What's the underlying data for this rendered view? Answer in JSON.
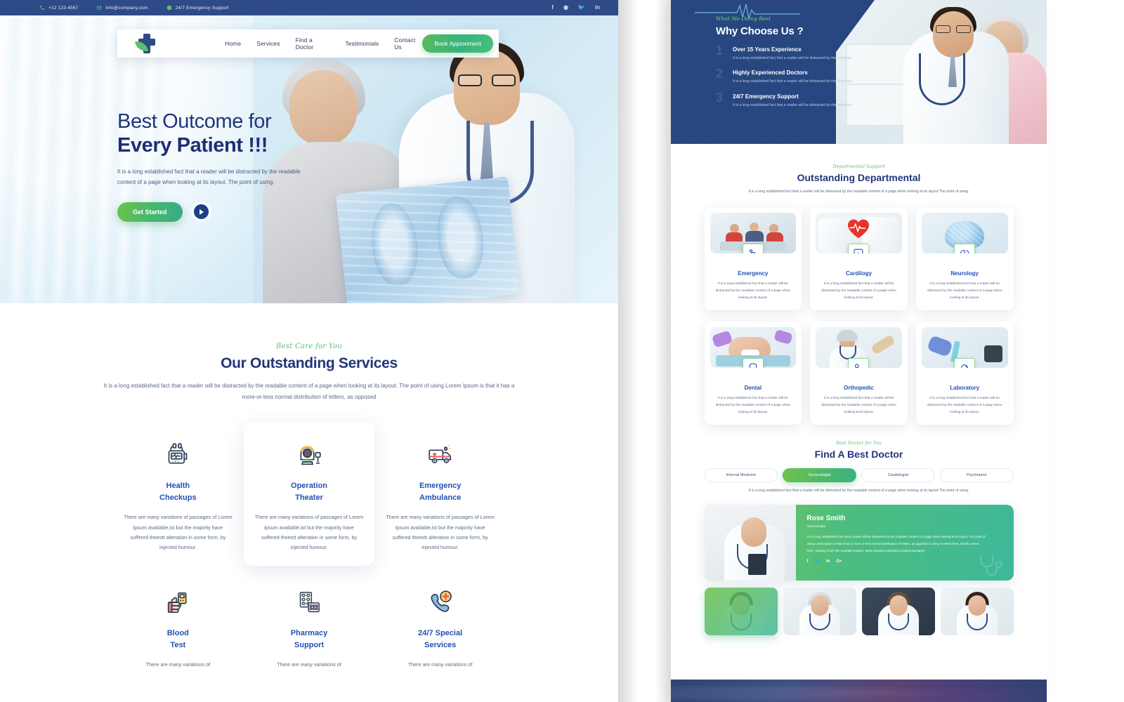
{
  "topbar": {
    "phone": "+12 123 4567",
    "email": "info@company.com",
    "support": "24/7 Emergency Support",
    "social": [
      "f",
      "◉",
      "🐦",
      "in"
    ]
  },
  "nav": {
    "logo_alt": "medical-cross-leaf-logo",
    "links": [
      "Home",
      "Services",
      "Find a Doctor",
      "Testimonials",
      "Contact Us"
    ],
    "cta": "Book Appionment"
  },
  "hero": {
    "line1": "Best Outcome for",
    "line2": "Every Patient !!!",
    "paragraph": "It is a long established fact that a reader will be distracted by the readable content of a page when looking at its layout. The point of using.",
    "primary_button": "Get Started",
    "play_label": "play-video"
  },
  "services": {
    "script": "Best Care for You",
    "title": "Our Outstanding Services",
    "subtitle": "It is a long established fact that a reader will be distracted by the readable content of a page when looking at its layout. The point of using Lorem Ipsum is that it has a more-or-less normal distribution of letters, as opposed",
    "items": [
      {
        "name": "Health\nCheckups",
        "icon": "monitor-icon",
        "desc": "There are many variations of passages of Lorem Ipsum available,ist but the majority have suffered theestt alteration in some form, by injected humour.",
        "highlight": false
      },
      {
        "name": "Operation\nTheater",
        "icon": "mri-scanner-icon",
        "desc": "There are many variations of passages of Lorem Ipsum available,ist but the majority have suffered theestt alteration in some form, by injected humour.",
        "highlight": true
      },
      {
        "name": "Emergency\nAmbulance",
        "icon": "ambulance-icon",
        "desc": "There are many variations of passages of Lorem Ipsum available,ist but the majority have suffered theestt alteration in some form, by injected humour.",
        "highlight": false
      },
      {
        "name": "Blood\nTest",
        "icon": "glucometer-icon",
        "desc": "There are many variations of",
        "highlight": false
      },
      {
        "name": "Pharmacy\nSupport",
        "icon": "pills-icon",
        "desc": "There are many variations of",
        "highlight": false
      },
      {
        "name": "24/7 Special\nServices",
        "icon": "phone-medical-icon",
        "desc": "There are many variations of",
        "highlight": false
      }
    ]
  },
  "why": {
    "script": "What We Doing Best",
    "title": "Why Choose Us ?",
    "items": [
      {
        "num": "1",
        "heading": "Over 15 Years Experience",
        "desc": "It is a long established fact that a reader will be distracted by the readable."
      },
      {
        "num": "2",
        "heading": "Highly Experienced Doctors",
        "desc": "It is a long established fact that a reader will be distracted by the readable."
      },
      {
        "num": "3",
        "heading": "24/7 Emergency Support",
        "desc": "It is a long established fact that a reader will be distracted by the readable."
      }
    ]
  },
  "departmental": {
    "script": "Departmental Support",
    "title": "Outstanding Departmental",
    "subtitle": "It is a long established fact that a reader will be distracted by the readable content of a page when looking at its layout The point of using.",
    "cards": [
      {
        "name": "Emergency",
        "icon": "stretcher-icon",
        "desc": "It is a long established fact that a reader will be distracted by the readable content of a page when looking at its layout."
      },
      {
        "name": "Cardilogy",
        "icon": "heart-monitor-icon",
        "desc": "It is a long established fact that a reader will be distracted by the readable content of a page when looking at its layout."
      },
      {
        "name": "Neurology",
        "icon": "brain-icon",
        "desc": "It is a long established fact that a reader will be distracted by the readable content of a page when looking at its layout."
      },
      {
        "name": "Dental",
        "icon": "tooth-icon",
        "desc": "It is a long established fact that a reader will be distracted by the readable content of a page when looking at its layout."
      },
      {
        "name": "Orthopedic",
        "icon": "bone-joint-icon",
        "desc": "It is a long established fact that a reader will be distracted by the readable content of a page when looking at its layout."
      },
      {
        "name": "Laboratory",
        "icon": "microscope-icon",
        "desc": "It is a long established fact that a reader will be distracted by the readable content of a page when looking at its layout."
      }
    ]
  },
  "find_doctor": {
    "script": "Best Doctor for You",
    "title": "Find A Best Doctor",
    "tabs": [
      {
        "label": "Internal Medicine",
        "active": false
      },
      {
        "label": "Gynecologist",
        "active": true
      },
      {
        "label": "Cardiologist",
        "active": false
      },
      {
        "label": "Psychiatrist",
        "active": false
      }
    ],
    "subtitle": "It is a long established fact that a reader will be distracted by the readable content of a page when looking at its layout The point of using.",
    "featured": {
      "name": "Rose Smith",
      "role": "Gynecologist",
      "bio": "It is a long established fact that a reader will be distracted by the readable content of a page when looking at its layout. The point of using Lorem Ipsum is that it has a more-or-less normal distribution of letters, as opposed to using 'Content here, Small content here', making it look like readable English. Many desktop publishing schaled packages",
      "social": [
        "f",
        "🐦",
        "in",
        "G+"
      ]
    },
    "thumbnails": [
      {
        "alt": "doctor-thumb-1",
        "active": true
      },
      {
        "alt": "doctor-thumb-2",
        "active": false
      },
      {
        "alt": "doctor-thumb-3",
        "active": false
      },
      {
        "alt": "doctor-thumb-4",
        "active": false
      }
    ]
  },
  "colors": {
    "navy": "#21357a",
    "topbar_blue": "#2e4a87",
    "panel_blue": "#274680",
    "green": "#5cc06f",
    "link_blue": "#2250b5"
  }
}
